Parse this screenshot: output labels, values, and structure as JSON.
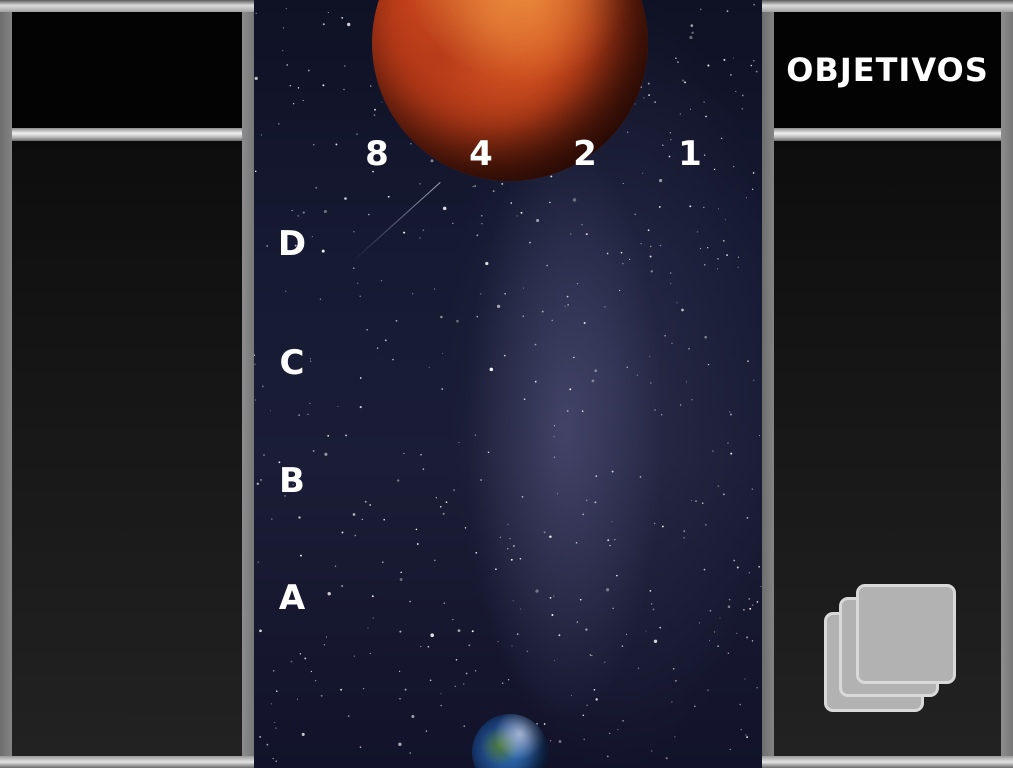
{
  "objectives_panel": {
    "title": "OBJETIVOS"
  },
  "grid": {
    "column_labels": [
      "8",
      "4",
      "2",
      "1"
    ],
    "row_labels": [
      "D",
      "C",
      "B",
      "A"
    ]
  },
  "scene": {
    "top_planet": "mars",
    "bottom_planet": "earth"
  },
  "icons": {
    "card_stack": "card-stack-icon"
  },
  "colors": {
    "panel_frame": "#c8c8c8",
    "panel_fill": "#111111",
    "space_bg": "#161a33",
    "mars": "#c8431b",
    "earth": "#2f6bb0",
    "card": "#b2b2b2"
  }
}
